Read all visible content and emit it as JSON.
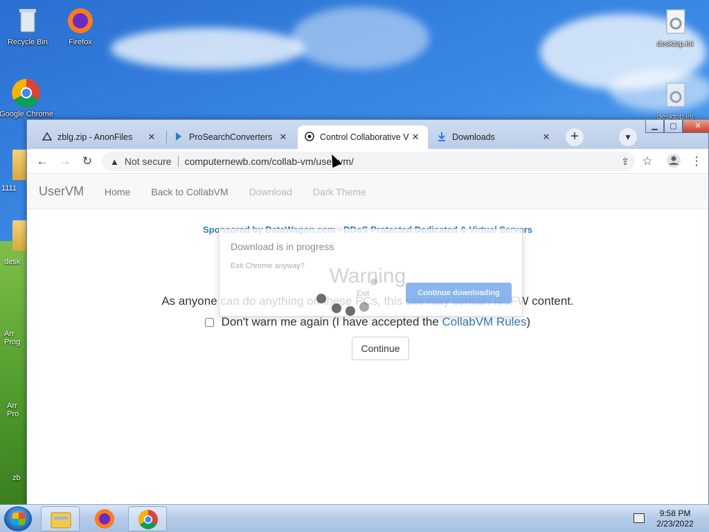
{
  "desktop": {
    "icons": [
      {
        "label": "Recycle Bin",
        "icon": "recycle-bin-icon"
      },
      {
        "label": "Firefox",
        "icon": "firefox-icon"
      },
      {
        "label": "Google Chrome",
        "icon": "chrome-icon"
      },
      {
        "label": "desktop.ini",
        "icon": "settings-file-icon"
      },
      {
        "label": "desktop.ini",
        "icon": "settings-file-icon"
      }
    ],
    "partial_labels": [
      "1111",
      "desk",
      "Arr Prog",
      "Arr Pro",
      "zb"
    ]
  },
  "browser": {
    "tabs": [
      {
        "title": "zblg.zip - AnonFiles",
        "icon": "anonfiles-icon",
        "active": false
      },
      {
        "title": "ProSearchConverters",
        "icon": "prosearch-icon",
        "active": false
      },
      {
        "title": "Control Collaborative V",
        "icon": "collabvm-icon",
        "active": true
      },
      {
        "title": "Downloads",
        "icon": "download-icon",
        "active": false
      }
    ],
    "new_tab": "+",
    "omnibox": {
      "security_text": "Not secure",
      "url": "computernewb.com/collab-vm/user-vm/"
    }
  },
  "page": {
    "navbar": {
      "brand": "UserVM",
      "links": [
        "Home",
        "Back to CollabVM",
        "Download",
        "Dark Theme"
      ]
    },
    "sponsor": "Sponsored by DataWagon.com - DDoS Protected Dedicated & Virtual Servers",
    "warning": {
      "title": "Warning",
      "text": "As anyone can do anything on these PCs, this site may contain NSFW content.",
      "checkbox_label": "Don't warn me again (I have accepted the ",
      "rules_link": "CollabVM Rules",
      "checkbox_tail": ")",
      "checked": false,
      "continue": "Continue"
    }
  },
  "dialog": {
    "title": "Download is in progress",
    "subtitle": "Exit Chrome anyway?",
    "exit": "Exit",
    "continue": "Continue downloading"
  },
  "taskbar": {
    "items": [
      "windows-explorer-icon",
      "firefox-icon",
      "chrome-icon"
    ],
    "time": "9:58 PM",
    "date": "2/23/2022"
  }
}
